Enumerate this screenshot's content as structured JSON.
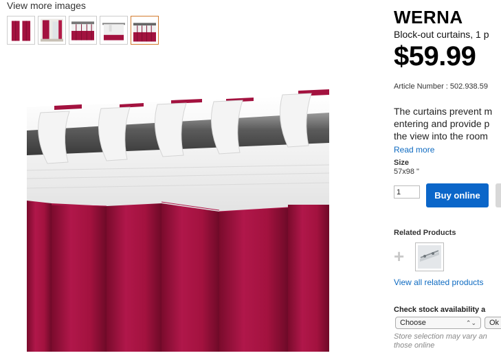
{
  "gallery": {
    "view_more_label": "View more images",
    "thumbnails": [
      {
        "name": "thumb-1",
        "active": false
      },
      {
        "name": "thumb-2",
        "active": false
      },
      {
        "name": "thumb-3",
        "active": false
      },
      {
        "name": "thumb-4",
        "active": false
      },
      {
        "name": "thumb-5",
        "active": true
      }
    ]
  },
  "product": {
    "title": "WERNA",
    "subtitle": "Block-out curtains, 1 p",
    "price": "$59.99",
    "article_number": "Article Number : 502.938.59",
    "description_lines": [
      "The curtains prevent m",
      "entering and provide p",
      "the view into the room"
    ],
    "read_more": "Read more",
    "size_label": "Size",
    "size_value": "57x98 \"",
    "quantity": "1",
    "buy_button": "Buy online"
  },
  "related": {
    "label": "Related Products",
    "plus_icon": "plus-icon",
    "view_all": "View all related products"
  },
  "stock": {
    "label": "Check stock availability a",
    "select_value": "Choose",
    "ok_label": "Ok",
    "note_line1": "Store selection may vary an",
    "note_line2": "those online"
  },
  "colors": {
    "curtain": "#a3123f",
    "buy_button": "#0b66c9",
    "link": "#0d6ac1",
    "active_thumb_border": "#d27a2c"
  }
}
